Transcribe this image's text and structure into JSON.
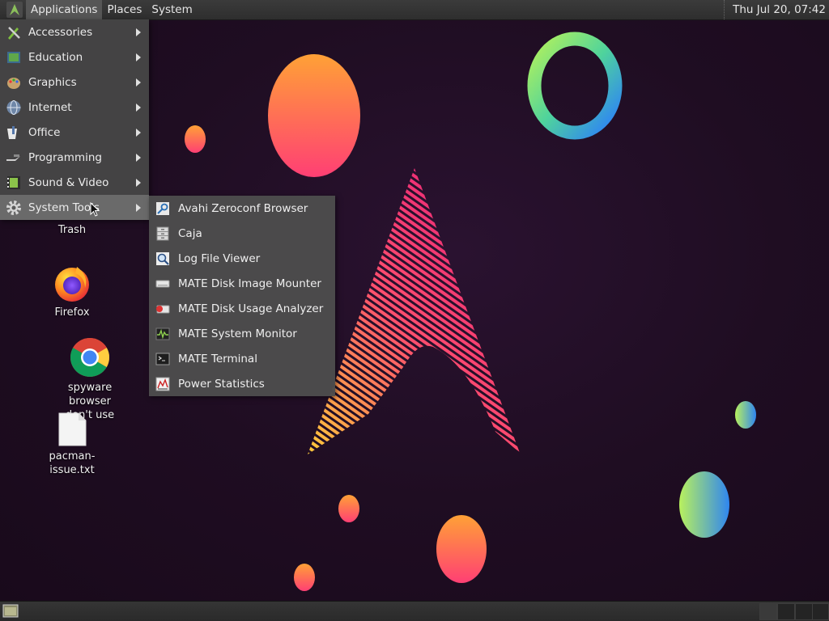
{
  "top_panel": {
    "menus": [
      "Applications",
      "Places",
      "System"
    ],
    "clock": "Thu Jul 20, 07:42"
  },
  "applications_menu": {
    "items": [
      {
        "label": "Accessories",
        "icon": "accessories-icon"
      },
      {
        "label": "Education",
        "icon": "education-icon"
      },
      {
        "label": "Graphics",
        "icon": "graphics-icon"
      },
      {
        "label": "Internet",
        "icon": "internet-icon"
      },
      {
        "label": "Office",
        "icon": "office-icon"
      },
      {
        "label": "Programming",
        "icon": "programming-icon"
      },
      {
        "label": "Sound & Video",
        "icon": "sound-video-icon"
      },
      {
        "label": "System Tools",
        "icon": "system-tools-icon"
      }
    ]
  },
  "system_tools_submenu": {
    "items": [
      {
        "label": "Avahi Zeroconf Browser",
        "icon": "avahi-icon"
      },
      {
        "label": "Caja",
        "icon": "file-cabinet-icon"
      },
      {
        "label": "Log File Viewer",
        "icon": "log-viewer-icon"
      },
      {
        "label": "MATE Disk Image Mounter",
        "icon": "disk-image-icon"
      },
      {
        "label": "MATE Disk Usage Analyzer",
        "icon": "disk-usage-icon"
      },
      {
        "label": "MATE System Monitor",
        "icon": "system-monitor-icon"
      },
      {
        "label": "MATE Terminal",
        "icon": "terminal-icon"
      },
      {
        "label": "Power Statistics",
        "icon": "power-statistics-icon"
      }
    ]
  },
  "desktop_icons": {
    "trash": "Trash",
    "firefox": "Firefox",
    "chrome_line1": "spyware browser",
    "chrome_line2": "don't use",
    "file": "pacman-issue.txt"
  }
}
